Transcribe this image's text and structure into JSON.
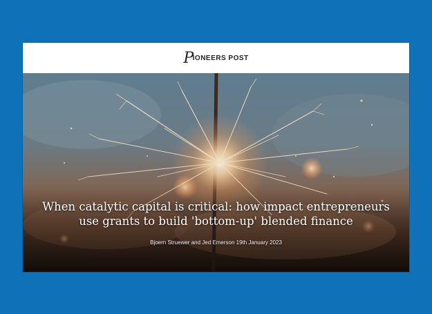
{
  "site": {
    "logo_initial": "P",
    "logo_text": "IONEERS POST"
  },
  "article": {
    "headline_line1": "When catalytic capital is critical: how impact entrepreneurs",
    "headline_line2": "use grants to build 'bottom-up' blended finance",
    "byline": "Bjoern Struewer and Jed Emerson 19th January 2023"
  },
  "colors": {
    "page_background": "#0f71b8",
    "header_background": "#ffffff",
    "headline_text": "#ffffff"
  },
  "hero_image": {
    "icon": "sparkler-image"
  }
}
